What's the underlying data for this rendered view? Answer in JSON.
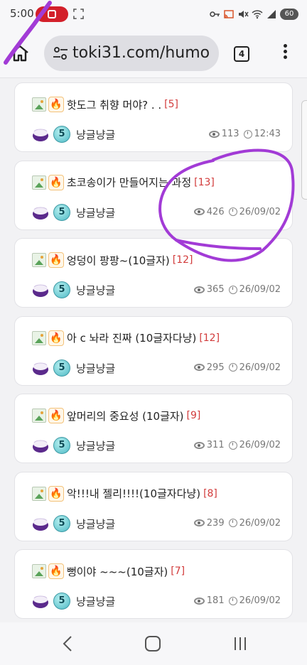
{
  "status_bar": {
    "time": "5:00",
    "battery": "60"
  },
  "browser": {
    "url": "toki31.com/humo",
    "tab_count": "4"
  },
  "feed": {
    "posts": [
      {
        "title": "핫도그 취향 머야? . .",
        "comment_count": "[5]",
        "level": "5",
        "author": "냥글냥글",
        "views": "113",
        "time": "12:43"
      },
      {
        "title": "초코송이가 만들어지는 과정",
        "comment_count": "[13]",
        "level": "5",
        "author": "냥글냥글",
        "views": "426",
        "time": "26/09/02"
      },
      {
        "title": "엉덩이 팡팡~(10글자)",
        "comment_count": "[12]",
        "level": "5",
        "author": "냥글냥글",
        "views": "365",
        "time": "26/09/02"
      },
      {
        "title": "아 c 놔라 진짜 (10글자다냥)",
        "comment_count": "[12]",
        "level": "5",
        "author": "냥글냥글",
        "views": "295",
        "time": "26/09/02"
      },
      {
        "title": "앞머리의 중요성 (10글자)",
        "comment_count": "[9]",
        "level": "5",
        "author": "냥글냥글",
        "views": "311",
        "time": "26/09/02"
      },
      {
        "title": "악!!!내 젤리!!!!(10글자다냥)",
        "comment_count": "[8]",
        "level": "5",
        "author": "냥글냥글",
        "views": "239",
        "time": "26/09/02"
      },
      {
        "title": "뻥이야 ~~~(10글자)",
        "comment_count": "[7]",
        "level": "5",
        "author": "냥글냥글",
        "views": "181",
        "time": "26/09/02"
      }
    ]
  },
  "colors": {
    "annotation": "#a23bd6",
    "comment_count": "#d23b3b",
    "rec_pill": "#d3202a"
  }
}
